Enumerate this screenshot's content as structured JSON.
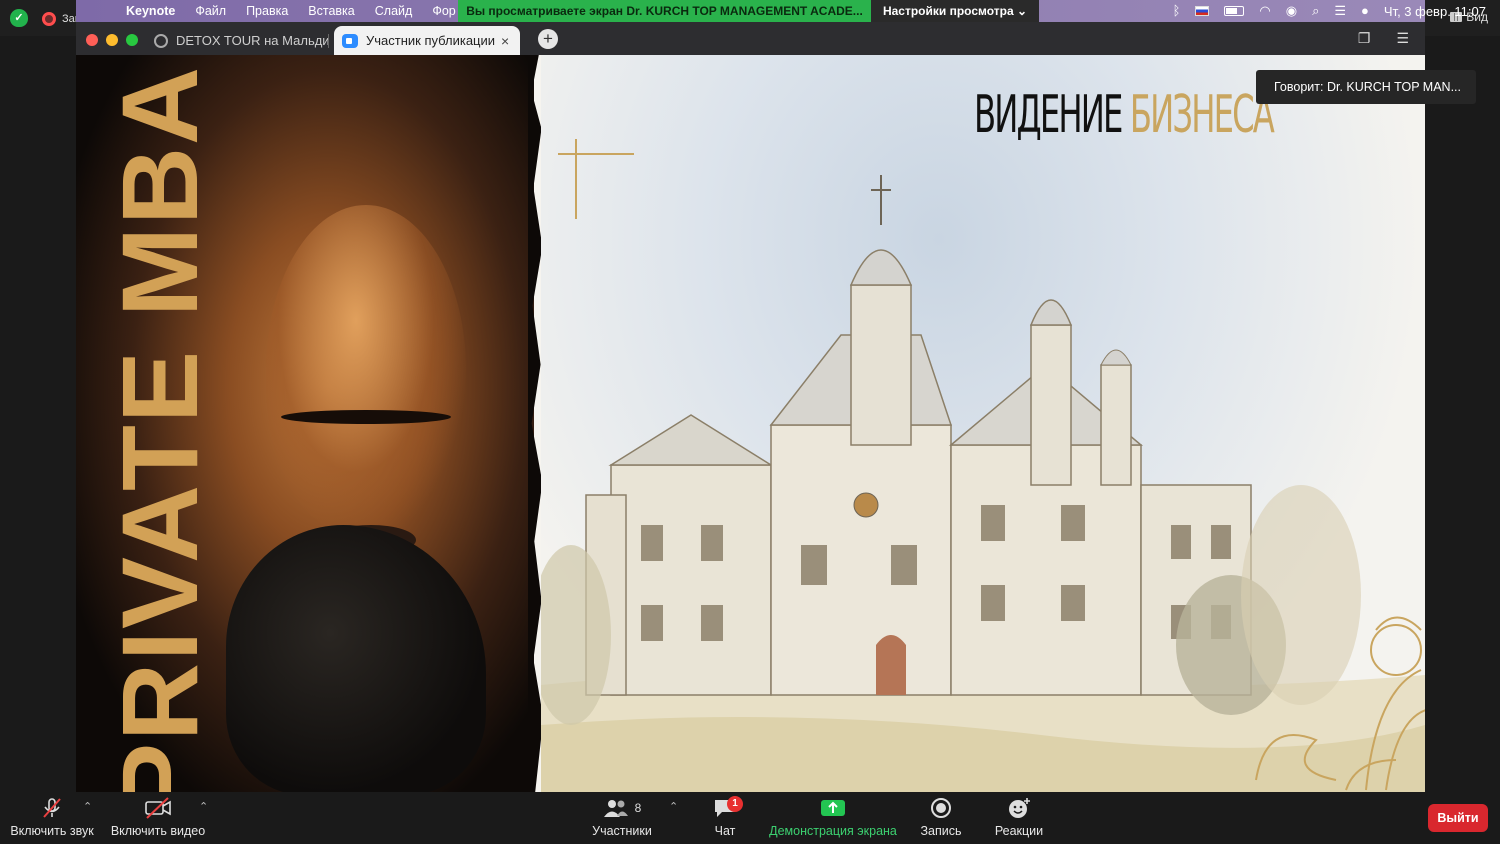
{
  "zoom_top": {
    "recording_label": "Запись",
    "view_label": "Вид"
  },
  "menubar": {
    "app_name": "Keynote",
    "items": [
      "Файл",
      "Правка",
      "Вставка",
      "Слайд",
      "Фор"
    ],
    "share_banner": "Вы просматриваете экран Dr. KURCH TOP MANAGEMENT ACADE...",
    "view_settings": "Настройки просмотра",
    "clock": "Чт, 3 февр.  11:07"
  },
  "browser": {
    "tabs": [
      {
        "title": "DETOX TOUR на Мальди"
      },
      {
        "title": "Участник публикации"
      }
    ]
  },
  "slide": {
    "vertical_text": "PRIVATE MBA",
    "title_dark": "ВИДЕНИЕ ",
    "title_gold": "БИЗНЕСА",
    "colors": {
      "gold": "#c9a55f",
      "dark": "#111111"
    }
  },
  "speaker": {
    "label": "Говорит: Dr. KURCH TOP MAN..."
  },
  "toolbar": {
    "unmute_label": "Включить звук",
    "video_label": "Включить видео",
    "participants_label": "Участники",
    "participants_count": "8",
    "chat_label": "Чат",
    "chat_badge": "1",
    "share_label": "Демонстрация экрана",
    "record_label": "Запись",
    "reactions_label": "Реакции",
    "leave_label": "Выйти"
  }
}
